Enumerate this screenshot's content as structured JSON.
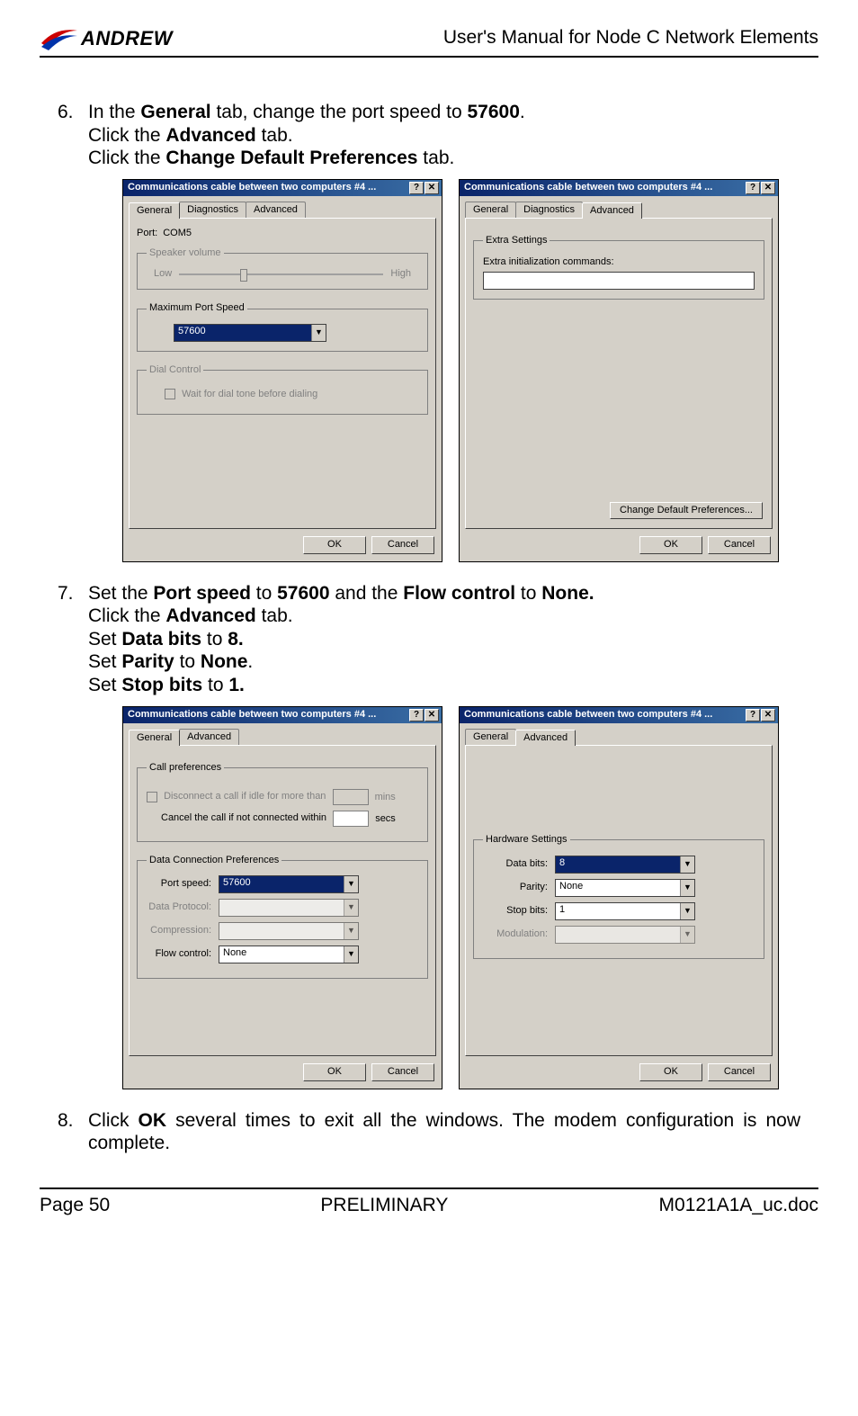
{
  "header": {
    "logo_text": "ANDREW",
    "manual_title": "User's Manual for Node C Network Elements"
  },
  "step6": {
    "number": "6.",
    "line1_pre": "In the ",
    "line1_bold1": "General",
    "line1_mid": " tab, change the port speed to ",
    "line1_bold2": "57600",
    "line1_post": ".",
    "line2_pre": "Click the ",
    "line2_bold": "Advanced",
    "line2_post": " tab.",
    "line3_pre": "Click the ",
    "line3_bold": "Change Default Preferences",
    "line3_post": " tab."
  },
  "step7": {
    "number": "7.",
    "line1_pre": "Set the ",
    "line1_b1": "Port speed",
    "line1_mid1": " to ",
    "line1_b2": "57600",
    "line1_mid2": " and the ",
    "line1_b3": "Flow control",
    "line1_mid3": " to ",
    "line1_b4": "None.",
    "line2_pre": "Click the ",
    "line2_bold": "Advanced",
    "line2_post": " tab.",
    "line3_pre": "Set ",
    "line3_b1": "Data bits",
    "line3_mid": " to ",
    "line3_b2": "8.",
    "line4_pre": "Set ",
    "line4_b1": "Parity",
    "line4_mid": " to ",
    "line4_b2": "None",
    "line4_post": ".",
    "line5_pre": "Set ",
    "line5_b1": "Stop bits",
    "line5_mid": " to ",
    "line5_b2": "1."
  },
  "step8": {
    "number": "8.",
    "text_pre": "Click ",
    "text_bold": "OK",
    "text_post": " several times to exit all the windows. The modem configuration is now complete."
  },
  "dialog_common": {
    "title": "Communications cable between two computers #4 ...",
    "help_char": "?",
    "close_char": "✕",
    "ok": "OK",
    "cancel": "Cancel",
    "dropdown_arrow": "▼"
  },
  "dlg1": {
    "tabs": [
      "General",
      "Diagnostics",
      "Advanced"
    ],
    "port_label": "Port:",
    "port_value": "COM5",
    "speaker_legend": "Speaker volume",
    "low": "Low",
    "high": "High",
    "max_port_legend": "Maximum Port Speed",
    "max_port_value": "57600",
    "dial_legend": "Dial Control",
    "dial_check": "Wait for dial tone before dialing"
  },
  "dlg2": {
    "tabs": [
      "General",
      "Diagnostics",
      "Advanced"
    ],
    "extra_legend": "Extra Settings",
    "extra_label": "Extra initialization commands:",
    "change_btn": "Change Default Preferences..."
  },
  "dlg3": {
    "tabs": [
      "General",
      "Advanced"
    ],
    "call_legend": "Call preferences",
    "disconnect_label": "Disconnect a call if idle for more than",
    "mins": "mins",
    "cancel_label": "Cancel the call if not connected within",
    "secs": "secs",
    "dcp_legend": "Data Connection Preferences",
    "port_speed_label": "Port speed:",
    "port_speed_value": "57600",
    "data_protocol_label": "Data Protocol:",
    "compression_label": "Compression:",
    "flow_label": "Flow control:",
    "flow_value": "None"
  },
  "dlg4": {
    "tabs": [
      "General",
      "Advanced"
    ],
    "hw_legend": "Hardware Settings",
    "data_bits_label": "Data bits:",
    "data_bits_value": "8",
    "parity_label": "Parity:",
    "parity_value": "None",
    "stop_bits_label": "Stop bits:",
    "stop_bits_value": "1",
    "modulation_label": "Modulation:"
  },
  "footer": {
    "page": "Page 50",
    "preliminary": "PRELIMINARY",
    "doc": "M0121A1A_uc.doc"
  }
}
